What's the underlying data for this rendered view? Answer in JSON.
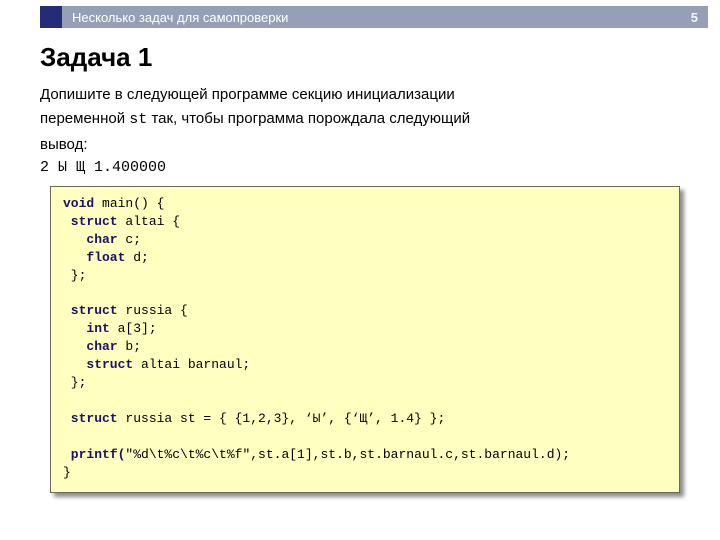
{
  "topbar": {
    "section_title": "Несколько задач для самопроверки",
    "slide_number": "5"
  },
  "content": {
    "heading": "Задача 1",
    "prompt_line1": "Допишите в следующей программе секцию инициализации",
    "prompt_line2_pre": "переменной ",
    "prompt_var": "st",
    "prompt_line2_post": " так, чтобы программа порождала следующий",
    "prompt_line3": "вывод:",
    "expected_output": "2 Ы Щ 1.400000"
  },
  "code": {
    "l01_a": "void",
    "l01_b": " main() {",
    "l02_a": " struct",
    "l02_b": " altai {",
    "l03_a": "   char",
    "l03_b": " c;",
    "l04_a": "   float",
    "l04_b": " d;",
    "l05": " };",
    "l06": "",
    "l07_a": " struct",
    "l07_b": " russia {",
    "l08_a": "   int",
    "l08_b": " a[3];",
    "l09_a": "   char",
    "l09_b": " b;",
    "l10_a": "   struct",
    "l10_b": " altai barnaul;",
    "l11": " };",
    "l12": "",
    "l13_a": " struct",
    "l13_b": " russia st = { {1,2,3}, ‘Ы’, {‘Щ’, 1.4} };",
    "l14": "",
    "l15_a": " printf(",
    "l15_b": "\"%d\\t%c\\t%c\\t%f\"",
    "l15_c": ",st.a[1],st.b,st.barnaul.c,st.barnaul.d);",
    "l16": "}"
  }
}
